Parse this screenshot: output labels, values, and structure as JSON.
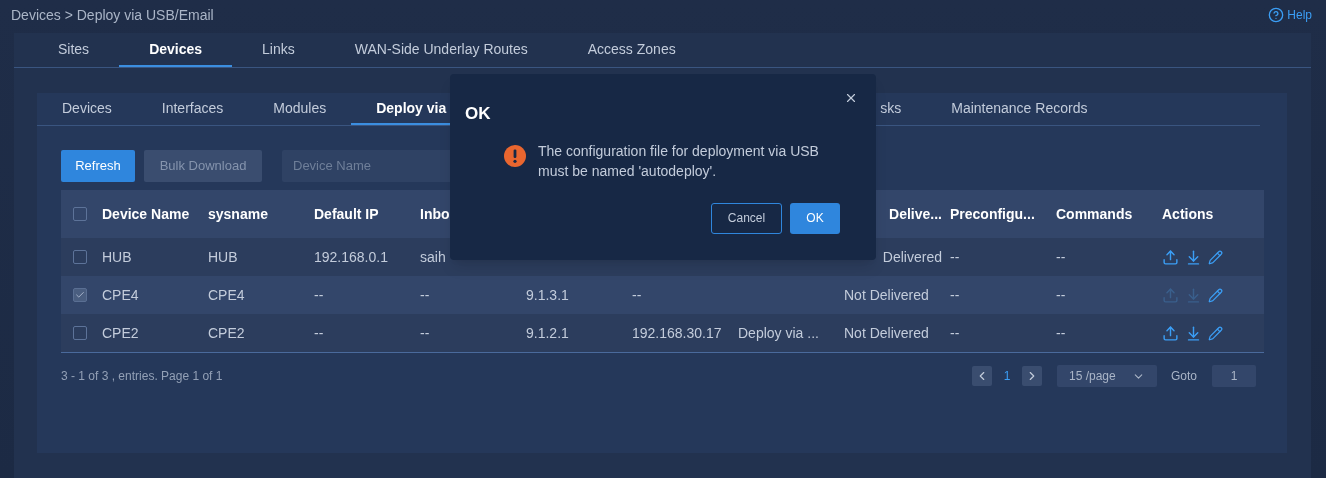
{
  "breadcrumb": "Devices > Deploy via USB/Email",
  "help": "Help",
  "tabs": [
    {
      "label": "Sites",
      "selected": false
    },
    {
      "label": "Devices",
      "selected": true
    },
    {
      "label": "Links",
      "selected": false
    },
    {
      "label": "WAN-Side Underlay Routes",
      "selected": false
    },
    {
      "label": "Access Zones",
      "selected": false
    }
  ],
  "sub_tabs": [
    {
      "label": "Devices",
      "selected": false
    },
    {
      "label": "Interfaces",
      "selected": false
    },
    {
      "label": "Modules",
      "selected": false
    },
    {
      "label": "Deploy via",
      "selected": true
    }
  ],
  "sub_tabs_right": [
    {
      "label": "sks",
      "selected": false
    },
    {
      "label": "Maintenance Records",
      "selected": false
    }
  ],
  "toolbar": {
    "refresh": "Refresh",
    "bulk_download": "Bulk Download",
    "bulk_download_disabled": true,
    "search_placeholder": "Device Name"
  },
  "table": {
    "header_checked": false,
    "columns": [
      "Device Name",
      "sysname",
      "Default IP",
      "Inbo",
      null,
      null,
      null,
      {
        "text": "Delive...",
        "kind": "tail"
      },
      "Preconfigu...",
      "Commands",
      "Actions"
    ],
    "rows": [
      {
        "checked": false,
        "actions_disabled": false,
        "cells": [
          "HUB",
          "HUB",
          "192.168.0.1",
          "saih",
          null,
          null,
          null,
          {
            "text": "Delivered",
            "kind": "tail"
          },
          "--",
          "--"
        ]
      },
      {
        "checked": true,
        "actions_disabled": true,
        "cells": [
          "CPE4",
          "CPE4",
          "--",
          "--",
          "9.1.3.1",
          "--",
          null,
          "Not Delivered",
          "--",
          "--"
        ]
      },
      {
        "checked": false,
        "actions_disabled": false,
        "cells": [
          "CPE2",
          "CPE2",
          "--",
          "--",
          "9.1.2.1",
          "192.168.30.17",
          "Deploy via ...",
          "Not Delivered",
          "--",
          "--"
        ]
      }
    ]
  },
  "footer": {
    "summary": "3 - 1 of 3 , entries. Page 1 of 1",
    "page": "1",
    "page_size": "15 /page",
    "goto_label": "Goto",
    "goto_value": "1"
  },
  "dialog": {
    "title": "OK",
    "message": "The configuration file for deployment via USB must be named 'autodeploy'.",
    "cancel": "Cancel",
    "ok": "OK"
  }
}
